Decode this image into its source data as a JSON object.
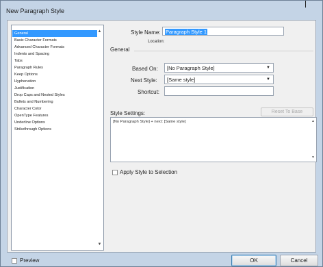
{
  "window": {
    "title": "New Paragraph Style"
  },
  "sidebar": {
    "items": [
      {
        "label": "General",
        "selected": true
      },
      {
        "label": "Basic Character Formats"
      },
      {
        "label": "Advanced Character Formats"
      },
      {
        "label": "Indents and Spacing"
      },
      {
        "label": "Tabs"
      },
      {
        "label": "Paragraph Rules"
      },
      {
        "label": "Keep Options"
      },
      {
        "label": "Hyphenation"
      },
      {
        "label": "Justification"
      },
      {
        "label": "Drop Caps and Nested Styles"
      },
      {
        "label": "Bullets and Numbering"
      },
      {
        "label": "Character Color"
      },
      {
        "label": "OpenType Features"
      },
      {
        "label": "Underline Options"
      },
      {
        "label": "Strikethrough Options"
      }
    ],
    "scroll_up_icon": "▲",
    "scroll_down_icon": "▼"
  },
  "form": {
    "style_name_label": "Style Name:",
    "style_name_value": "Paragraph Style 1",
    "location_label": "Location:",
    "section_title": "General",
    "based_on_label": "Based On:",
    "based_on_value": "[No Paragraph Style]",
    "next_style_label": "Next Style:",
    "next_style_value": "[Same style]",
    "shortcut_label": "Shortcut:",
    "shortcut_value": "",
    "dropdown_icon": "▼",
    "style_settings_label": "Style Settings:",
    "reset_button": "Reset To Base",
    "settings_text": "[No Paragraph Style] + next: [Same style]",
    "apply_label": "Apply Style to Selection"
  },
  "footer": {
    "preview_label": "Preview",
    "ok_button": "OK",
    "cancel_button": "Cancel"
  }
}
